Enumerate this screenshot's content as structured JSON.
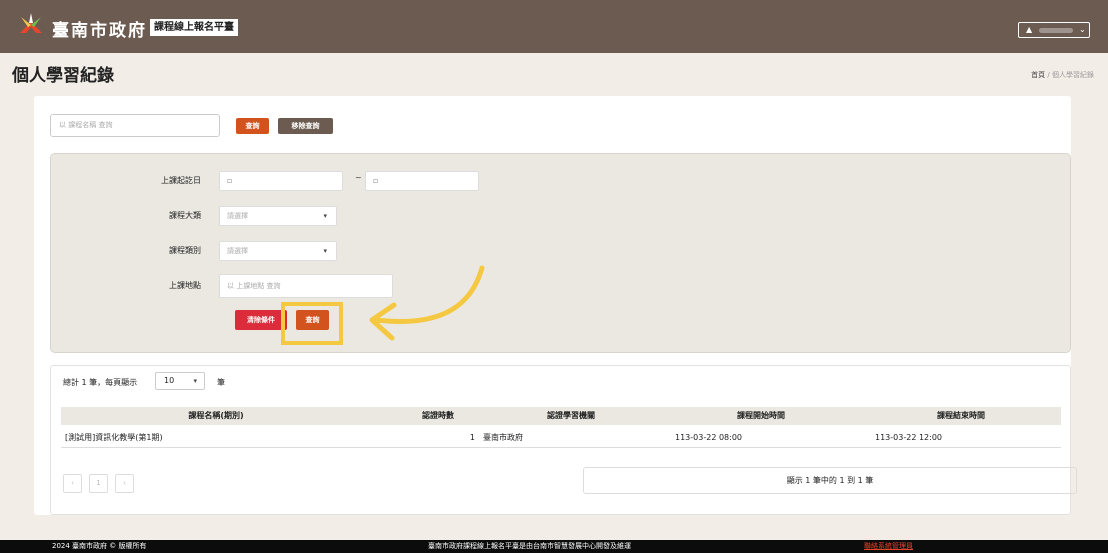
{
  "header": {
    "site_title": "臺南市政府",
    "site_subtitle": "課程線上報名平臺",
    "user_icon": "user-icon",
    "user_caret": "⌄"
  },
  "page": {
    "title": "個人學習紀錄",
    "breadcrumb_home": "首頁",
    "breadcrumb_sep": "/",
    "breadcrumb_current": "個人學習紀錄"
  },
  "search": {
    "placeholder": "以 課程名稱 查詢",
    "search_label": "查詢",
    "clear_label": "移除查詢"
  },
  "filters": {
    "date_label": "上課起訖日",
    "date_from": "",
    "date_to": "",
    "date_separator": "~",
    "category_label": "課程大類",
    "category_value": "請選擇",
    "type_label": "課程類別",
    "type_value": "請選擇",
    "location_label": "上課地點",
    "location_placeholder": "以 上課地點 查詢",
    "clear_conditions_label": "清除條件",
    "query_label": "查詢"
  },
  "results": {
    "count_text": "總計 1 筆，每頁顯示",
    "page_size": "10",
    "unit": "筆",
    "columns": [
      "課程名稱(期別)",
      "認證時數",
      "認證學習機關",
      "課程開始時間",
      "課程結束時間"
    ],
    "rows": [
      [
        "[測試用]資訊化教學(第1期)",
        "1",
        "臺南市政府",
        "113-03-22 08:00",
        "113-03-22 12:00"
      ]
    ],
    "pager": [
      "‹",
      "1",
      "›"
    ],
    "info": "顯示 1 筆中的 1 到 1 筆"
  },
  "footer": {
    "copyright": "2024 臺南市政府 © 版權所有",
    "maintainer": "臺南市政府課程線上報名平臺是由台南市智慧發展中心開發及維運",
    "contact": "聯絡系統管理員"
  },
  "colors": {
    "header_bg": "#6b5b50",
    "primary": "#d3531f",
    "danger": "#dc2b3b",
    "highlight": "#f5c842"
  }
}
